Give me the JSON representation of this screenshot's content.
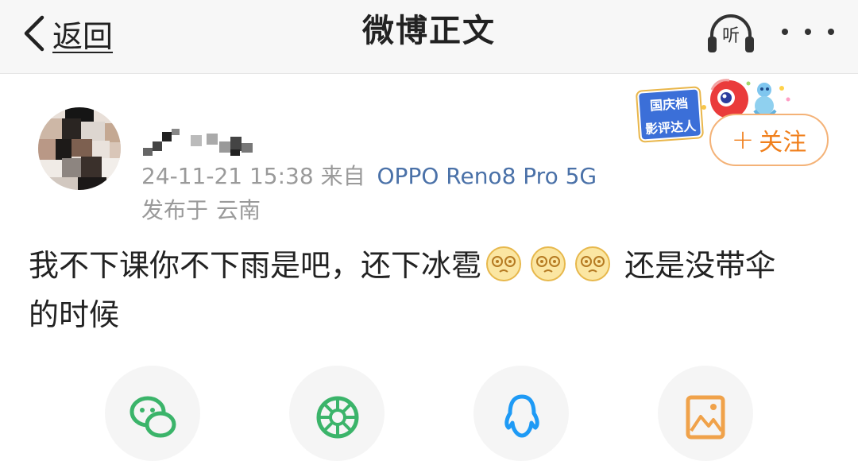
{
  "nav": {
    "back_label": "返回",
    "title": "微博正文",
    "listen_label": "听"
  },
  "post": {
    "meta_time": "24-11-21 15:38",
    "meta_from": "来自",
    "meta_source": "OPPO Reno8 Pro 5G",
    "location_prefix": "发布于",
    "location": "云南",
    "text_part1": "我不下课你不下雨是吧，还下冰雹",
    "text_part2": "还是没带伞",
    "text_part3": "的时候",
    "emojis": [
      "dizzy-face-emoji",
      "dizzy-face-emoji",
      "dizzy-face-emoji"
    ]
  },
  "badge": {
    "line1": "国庆档",
    "line2": "影评达人"
  },
  "follow": {
    "label": "关注",
    "plus": "+"
  },
  "share": {
    "icons": [
      "wechat-icon",
      "moments-icon",
      "qq-icon",
      "save-image-icon"
    ]
  },
  "colors": {
    "link": "#4a71a8",
    "accent": "#f07f1b",
    "muted": "#9a9a9a",
    "wechat": "#3bb46a",
    "qq": "#1e9af5",
    "image": "#f0a24a"
  }
}
